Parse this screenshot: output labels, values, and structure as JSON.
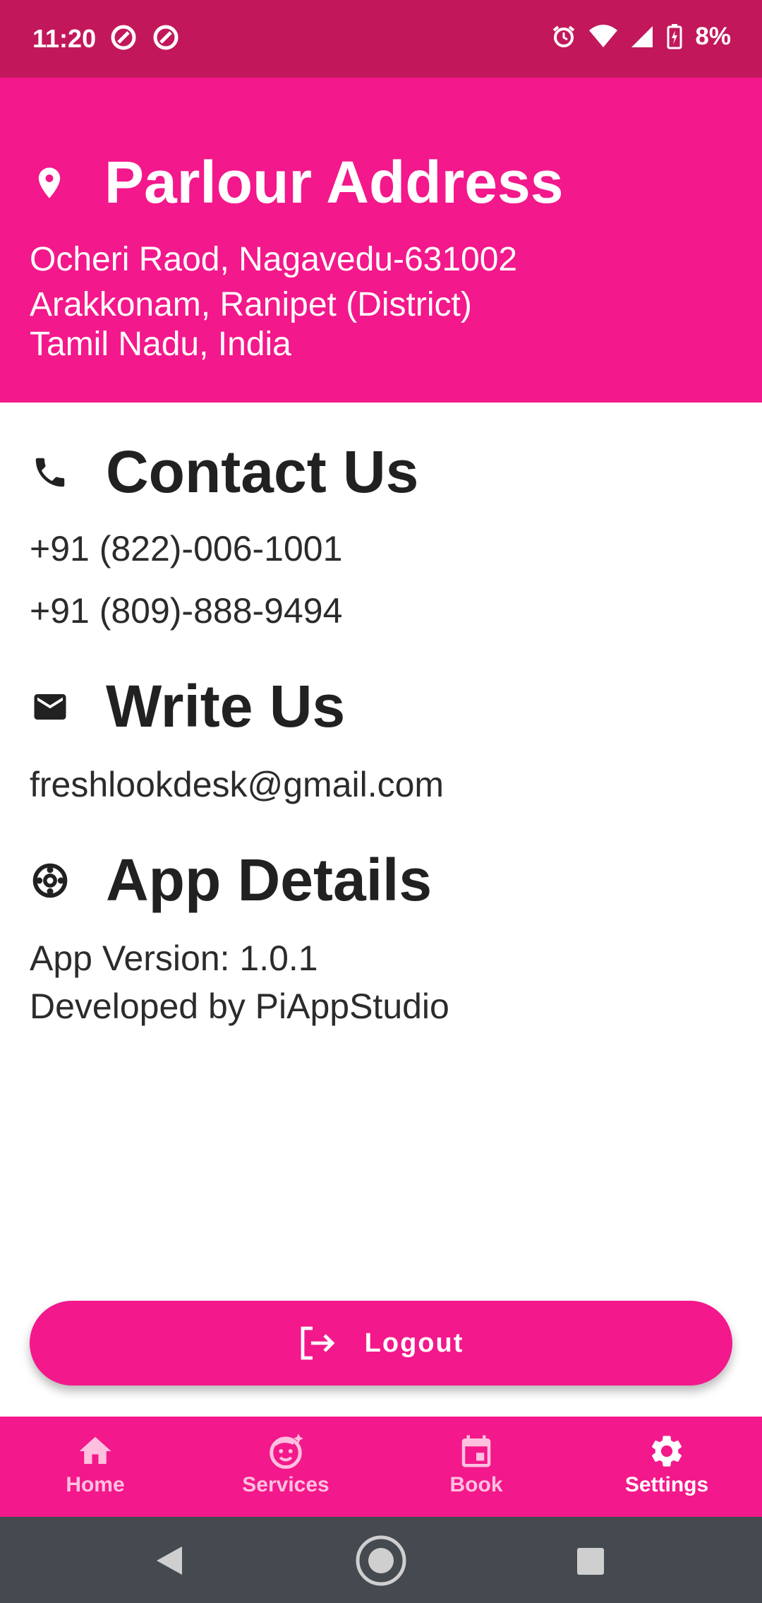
{
  "status_bar": {
    "time": "11:20",
    "battery_text": "8%",
    "icons": [
      "notification-icon",
      "notification-icon",
      "alarm-icon",
      "wifi-icon",
      "signal-icon",
      "battery-icon"
    ]
  },
  "header": {
    "title": "Parlour Address",
    "icon": "location-pin-icon",
    "lines": [
      "Ocheri Raod, Nagavedu-631002",
      "Arakkonam, Ranipet (District)",
      "Tamil Nadu, India"
    ]
  },
  "contact": {
    "title": "Contact Us",
    "icon": "phone-icon",
    "phones": [
      "+91 (822)-006-1001",
      "+91 (809)-888-9494"
    ]
  },
  "write": {
    "title": "Write Us",
    "icon": "mail-icon",
    "email": "freshlookdesk@gmail.com"
  },
  "app_details": {
    "title": "App Details",
    "icon": "support-icon",
    "version": "App Version: 1.0.1",
    "developer": "Developed by PiAppStudio"
  },
  "logout": {
    "label": "Logout",
    "icon": "logout-icon"
  },
  "bottom_nav": {
    "items": [
      {
        "label": "Home",
        "icon": "home-icon",
        "active": false
      },
      {
        "label": "Services",
        "icon": "face-icon",
        "active": false
      },
      {
        "label": "Book",
        "icon": "calendar-icon",
        "active": false
      },
      {
        "label": "Settings",
        "icon": "gear-icon",
        "active": true
      }
    ]
  },
  "colors": {
    "primary": "#f3188b",
    "status_bar": "#c2185b",
    "system_nav": "#444a50",
    "text_dark": "#212121"
  }
}
